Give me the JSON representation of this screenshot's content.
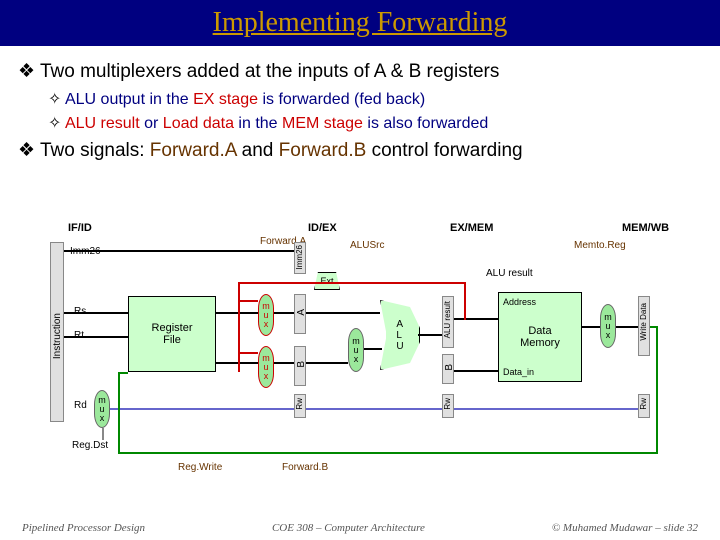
{
  "title": "Implementing Forwarding",
  "bullets": {
    "p1": "Two multiplexers added at the inputs of A & B registers",
    "p1a_pre": "ALU output in the ",
    "p1a_em": "EX stage",
    "p1a_post": " is forwarded (fed back)",
    "p1b_pre1": "ALU result",
    "p1b_mid1": " or ",
    "p1b_em2": "Load data",
    "p1b_mid2": " in the ",
    "p1b_em3": "MEM stage",
    "p1b_post": " is also forwarded",
    "p2_pre": "Two signals: ",
    "p2_em1": "Forward.A",
    "p2_mid": " and ",
    "p2_em2": "Forward.B",
    "p2_post": " control forwarding"
  },
  "labels": {
    "ifid": "IF/ID",
    "idex": "ID/EX",
    "exmem": "EX/MEM",
    "memwb": "MEM/WB",
    "imm26": "Imm26",
    "imm26b": "Imm26",
    "instruction": "Instruction",
    "rs": "Rs",
    "rt": "Rt",
    "rd": "Rd",
    "regfile": "Register\nFile",
    "forwardA": "Forward.A",
    "forwardB": "Forward.B",
    "alusrc": "ALUSrc",
    "ext": "Ext",
    "alu": "A\nL\nU",
    "aluresult": "ALU result",
    "aluresult_v": "ALU result",
    "address": "Address",
    "datamem": "Data\nMemory",
    "datain": "Data_in",
    "memtoreg": "Memto.Reg",
    "writedata": "Write Data",
    "regdst": "Reg.Dst",
    "regwrite": "Reg.Write",
    "mux": "m\nu\nx",
    "A": "A",
    "B": "B",
    "Bv": "B",
    "rwv": "Rw",
    "rwv2": "Rw",
    "rwv3": "Rw"
  },
  "footer": {
    "left": "Pipelined Processor Design",
    "center": "COE 308 – Computer Architecture",
    "right": "© Muhamed Mudawar – slide 32"
  },
  "colors": {
    "title": "#cc9900",
    "em": "#cc0000",
    "brown": "#663300",
    "navy": "#000080"
  }
}
